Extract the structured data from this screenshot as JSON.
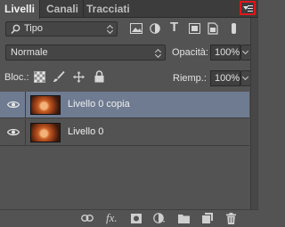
{
  "tabs": [
    {
      "label": "Livelli",
      "active": true
    },
    {
      "label": "Canali",
      "active": false
    },
    {
      "label": "Tracciati",
      "active": false
    }
  ],
  "filter": {
    "kind_label": "Tipo"
  },
  "blend": {
    "mode": "Normale",
    "opacity_label": "Opacità:",
    "opacity_value": "100%"
  },
  "lock": {
    "label": "Bloc.:",
    "fill_label": "Riemp.:",
    "fill_value": "100%"
  },
  "layers": [
    {
      "name": "Livello 0 copia",
      "visible": true,
      "selected": true
    },
    {
      "name": "Livello 0",
      "visible": true,
      "selected": false
    }
  ],
  "footer_icons": [
    "link-icon",
    "fx-icon",
    "mask-icon",
    "adjustment-icon",
    "folder-icon",
    "new-layer-icon",
    "trash-icon"
  ],
  "colors": {
    "panel": "#535353",
    "selection": "#6e7b91",
    "highlight": "#e0161b"
  }
}
